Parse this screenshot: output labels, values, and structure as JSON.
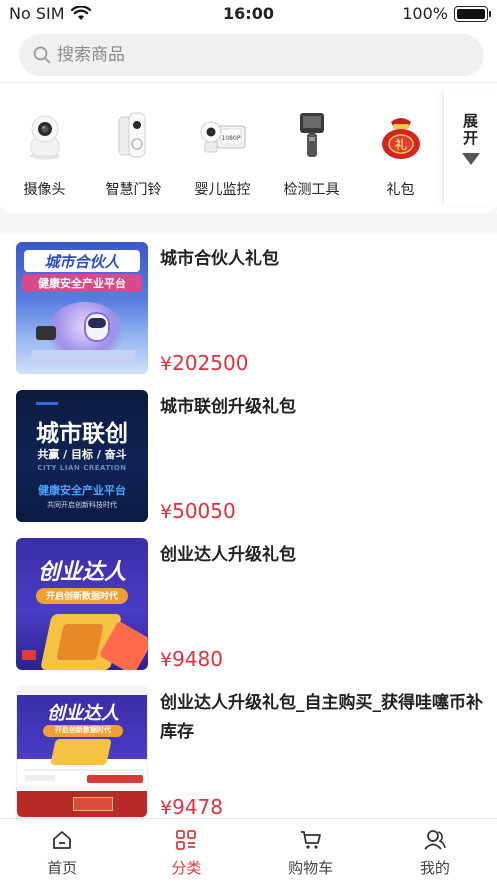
{
  "status_bar": {
    "carrier": "No SIM",
    "time": "16:00",
    "battery": "100%",
    "battery_level": 1.0
  },
  "search": {
    "placeholder": "搜索商品",
    "value": ""
  },
  "categories": {
    "items": [
      {
        "label": "摄像头",
        "icon": "security-camera-icon"
      },
      {
        "label": "智慧门铃",
        "icon": "smart-doorbell-icon"
      },
      {
        "label": "婴儿监控",
        "icon": "baby-monitor-icon"
      },
      {
        "label": "检测工具",
        "icon": "tester-tool-icon"
      },
      {
        "label": "礼包",
        "icon": "gift-bag-icon"
      }
    ],
    "expand_label": "展开"
  },
  "products": [
    {
      "title": "城市合伙人礼包",
      "currency": "¥",
      "price": "202500",
      "thumb": {
        "line1": "城市合伙人",
        "line2": "健康安全产业平台"
      }
    },
    {
      "title": "城市联创升级礼包",
      "currency": "¥",
      "price": "50050",
      "thumb": {
        "line1": "城市联创",
        "line2": "共赢 / 目标 / 奋斗",
        "line3": "CITY LIAN CREATION",
        "line4": "健康安全产业平台",
        "line5": "共同开启创新科技时代"
      }
    },
    {
      "title": "创业达人升级礼包",
      "currency": "¥",
      "price": "9480",
      "thumb": {
        "line1": "创业达人",
        "line2": "开启创新数据时代"
      }
    },
    {
      "title": "创业达人升级礼包_自主购买_获得哇噻币补库存",
      "currency": "¥",
      "price": "9478",
      "thumb": {
        "line1": "创业达人",
        "line2": "开启创新数据时代"
      }
    }
  ],
  "tabs": [
    {
      "label": "首页",
      "icon": "home-icon",
      "active": false
    },
    {
      "label": "分类",
      "icon": "category-icon",
      "active": true
    },
    {
      "label": "购物车",
      "icon": "cart-icon",
      "active": false
    },
    {
      "label": "我的",
      "icon": "profile-icon",
      "active": false
    }
  ],
  "colors": {
    "accent": "#d83a3a",
    "price": "#e0303e"
  }
}
